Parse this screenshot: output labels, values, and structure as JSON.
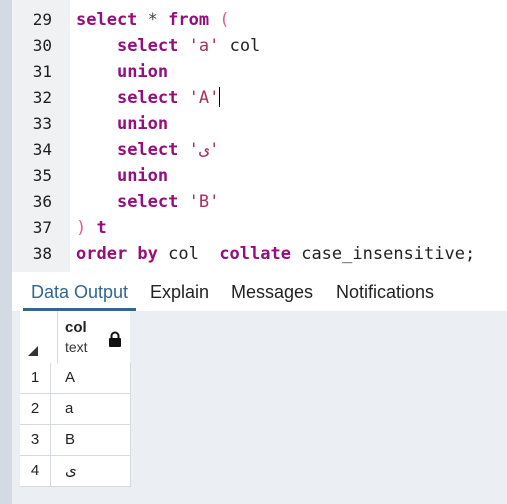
{
  "editor": {
    "lines": [
      {
        "num": "29",
        "tokens": [
          {
            "t": "select",
            "c": "kw"
          },
          {
            "t": " ",
            "c": ""
          },
          {
            "t": "*",
            "c": "op"
          },
          {
            "t": " ",
            "c": ""
          },
          {
            "t": "from",
            "c": "kw"
          },
          {
            "t": " ",
            "c": ""
          },
          {
            "t": "(",
            "c": "paren"
          }
        ]
      },
      {
        "num": "30",
        "tokens": [
          {
            "t": "    ",
            "c": ""
          },
          {
            "t": "select",
            "c": "kw"
          },
          {
            "t": " ",
            "c": ""
          },
          {
            "t": "'a'",
            "c": "str"
          },
          {
            "t": " col",
            "c": ""
          }
        ]
      },
      {
        "num": "31",
        "tokens": [
          {
            "t": "    ",
            "c": ""
          },
          {
            "t": "union",
            "c": "kw"
          }
        ]
      },
      {
        "num": "32",
        "tokens": [
          {
            "t": "    ",
            "c": ""
          },
          {
            "t": "select",
            "c": "kw"
          },
          {
            "t": " ",
            "c": ""
          },
          {
            "t": "'A'",
            "c": "str"
          }
        ],
        "cursor": true
      },
      {
        "num": "33",
        "tokens": [
          {
            "t": "    ",
            "c": ""
          },
          {
            "t": "union",
            "c": "kw"
          }
        ]
      },
      {
        "num": "34",
        "tokens": [
          {
            "t": "    ",
            "c": ""
          },
          {
            "t": "select",
            "c": "kw"
          },
          {
            "t": " ",
            "c": ""
          },
          {
            "t": "'ی'",
            "c": "str"
          }
        ]
      },
      {
        "num": "35",
        "tokens": [
          {
            "t": "    ",
            "c": ""
          },
          {
            "t": "union",
            "c": "kw"
          }
        ]
      },
      {
        "num": "36",
        "tokens": [
          {
            "t": "    ",
            "c": ""
          },
          {
            "t": "select",
            "c": "kw"
          },
          {
            "t": " ",
            "c": ""
          },
          {
            "t": "'B'",
            "c": "str"
          }
        ]
      },
      {
        "num": "37",
        "tokens": [
          {
            "t": ")",
            "c": "paren"
          },
          {
            "t": " t",
            "c": "kw"
          }
        ]
      },
      {
        "num": "38",
        "tokens": [
          {
            "t": "order by",
            "c": "kw"
          },
          {
            "t": " col  ",
            "c": ""
          },
          {
            "t": "collate",
            "c": "kw"
          },
          {
            "t": " case_insensitive;",
            "c": ""
          }
        ]
      }
    ]
  },
  "tabs": {
    "data_output": "Data Output",
    "explain": "Explain",
    "messages": "Messages",
    "notifications": "Notifications"
  },
  "grid": {
    "column_name": "col",
    "column_type": "text",
    "rows": [
      {
        "num": "1",
        "value": "A"
      },
      {
        "num": "2",
        "value": "a"
      },
      {
        "num": "3",
        "value": "B"
      },
      {
        "num": "4",
        "value": "ی"
      }
    ]
  },
  "colors": {
    "keyword": "#960d7d",
    "string": "#a8305a",
    "active_tab": "#326690"
  }
}
